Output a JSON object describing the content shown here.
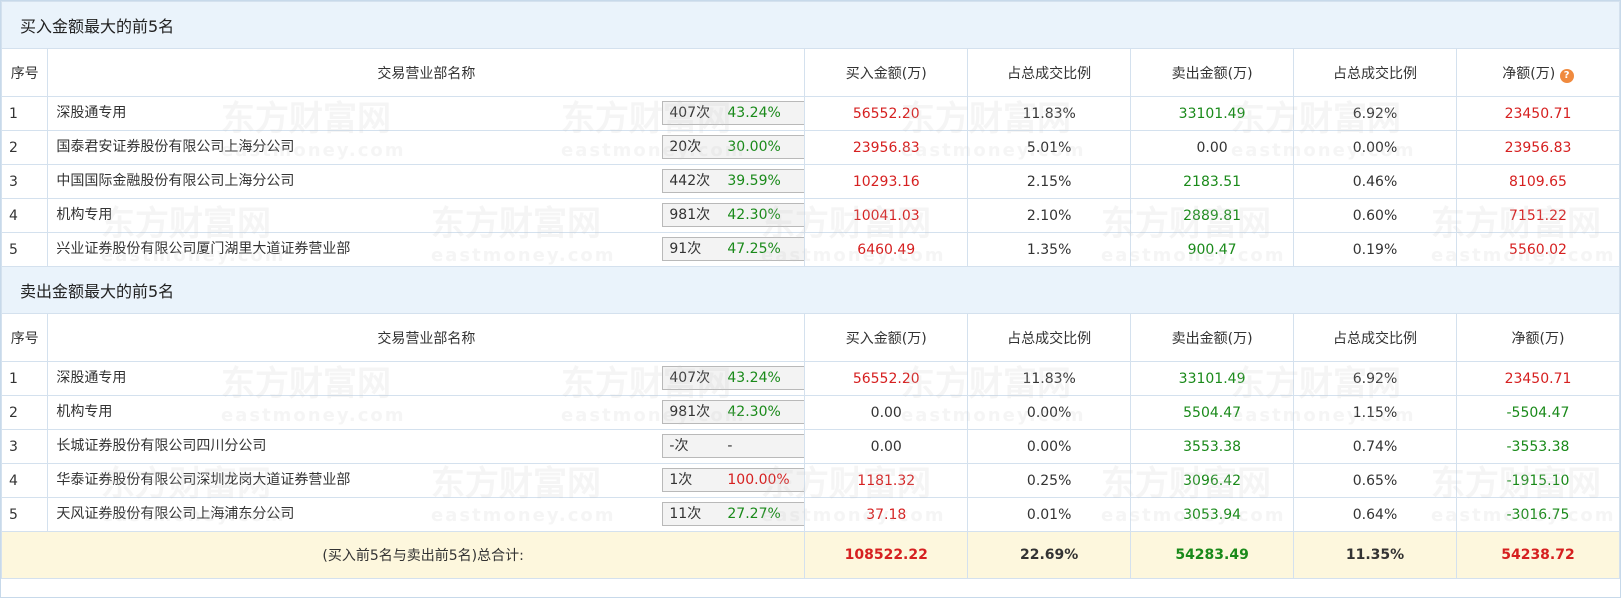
{
  "buy_section": {
    "title": "买入金额最大的前5名",
    "headers": [
      "序号",
      "交易营业部名称",
      "买入金额(万)",
      "占总成交比例",
      "卖出金额(万)",
      "占总成交比例",
      "净额(万)"
    ],
    "rows": [
      {
        "seq": "1",
        "name": "深股通专用",
        "count": "407次",
        "pct": "43.24%",
        "pct_color": "green",
        "icon": "question-icon",
        "buy": "56552.20",
        "buy_ratio": "11.83%",
        "sell": "33101.49",
        "sell_ratio": "6.92%",
        "net": "23450.71",
        "net_color": "red"
      },
      {
        "seq": "2",
        "name": "国泰君安证券股份有限公司上海分公司",
        "count": "20次",
        "pct": "30.00%",
        "pct_color": "green",
        "icon": "play-arrow-icon",
        "buy": "23956.83",
        "buy_ratio": "5.01%",
        "sell": "0.00",
        "sell_ratio": "0.00%",
        "net": "23956.83",
        "net_color": "red"
      },
      {
        "seq": "3",
        "name": "中国国际金融股份有限公司上海分公司",
        "count": "442次",
        "pct": "39.59%",
        "pct_color": "green",
        "icon": "play-arrow-icon",
        "buy": "10293.16",
        "buy_ratio": "2.15%",
        "sell": "2183.51",
        "sell_ratio": "0.46%",
        "net": "8109.65",
        "net_color": "red"
      },
      {
        "seq": "4",
        "name": "机构专用",
        "count": "981次",
        "pct": "42.30%",
        "pct_color": "green",
        "icon": "play-arrow-icon",
        "buy": "10041.03",
        "buy_ratio": "2.10%",
        "sell": "2889.81",
        "sell_ratio": "0.60%",
        "net": "7151.22",
        "net_color": "red"
      },
      {
        "seq": "5",
        "name": "兴业证券股份有限公司厦门湖里大道证券营业部",
        "count": "91次",
        "pct": "47.25%",
        "pct_color": "green",
        "icon": "play-arrow-icon",
        "buy": "6460.49",
        "buy_ratio": "1.35%",
        "sell": "900.47",
        "sell_ratio": "0.19%",
        "net": "5560.02",
        "net_color": "red"
      }
    ]
  },
  "sell_section": {
    "title": "卖出金额最大的前5名",
    "headers": [
      "序号",
      "交易营业部名称",
      "买入金额(万)",
      "占总成交比例",
      "卖出金额(万)",
      "占总成交比例",
      "净额(万)"
    ],
    "rows": [
      {
        "seq": "1",
        "name": "深股通专用",
        "count": "407次",
        "pct": "43.24%",
        "pct_color": "green",
        "icon": "question-icon",
        "buy": "56552.20",
        "buy_ratio": "11.83%",
        "sell": "33101.49",
        "sell_ratio": "6.92%",
        "net": "23450.71",
        "net_color": "red"
      },
      {
        "seq": "2",
        "name": "机构专用",
        "count": "981次",
        "pct": "42.30%",
        "pct_color": "green",
        "icon": "play-arrow-icon",
        "buy": "0.00",
        "buy_ratio": "0.00%",
        "sell": "5504.47",
        "sell_ratio": "1.15%",
        "net": "-5504.47",
        "net_color": "green"
      },
      {
        "seq": "3",
        "name": "长城证券股份有限公司四川分公司",
        "count": "-次",
        "pct": "-",
        "pct_color": "plain",
        "icon": "play-arrow-icon",
        "buy": "0.00",
        "buy_ratio": "0.00%",
        "sell": "3553.38",
        "sell_ratio": "0.74%",
        "net": "-3553.38",
        "net_color": "green"
      },
      {
        "seq": "4",
        "name": "华泰证券股份有限公司深圳龙岗大道证券营业部",
        "count": "1次",
        "pct": "100.00%",
        "pct_color": "red",
        "icon": "play-arrow-icon",
        "buy": "1181.32",
        "buy_ratio": "0.25%",
        "sell": "3096.42",
        "sell_ratio": "0.65%",
        "net": "-1915.10",
        "net_color": "green"
      },
      {
        "seq": "5",
        "name": "天风证券股份有限公司上海浦东分公司",
        "count": "11次",
        "pct": "27.27%",
        "pct_color": "green",
        "icon": "play-arrow-icon",
        "buy": "37.18",
        "buy_ratio": "0.01%",
        "sell": "3053.94",
        "sell_ratio": "0.64%",
        "net": "-3016.75",
        "net_color": "green"
      }
    ]
  },
  "total": {
    "label": "(买入前5名与卖出前5名)总合计:",
    "buy": "108522.22",
    "buy_ratio": "22.69%",
    "sell": "54283.49",
    "sell_ratio": "11.35%",
    "net": "54238.72"
  },
  "watermark": {
    "text": "东方财富网",
    "sub": "eastmoney.com"
  },
  "colors": {
    "red": "#d62020",
    "green": "#1a8a1a",
    "header_bg": "#eaf3fb",
    "total_bg": "#fdf7dd",
    "question_icon": "#f08a3e",
    "arrow_icon": "#1f4e8c"
  }
}
